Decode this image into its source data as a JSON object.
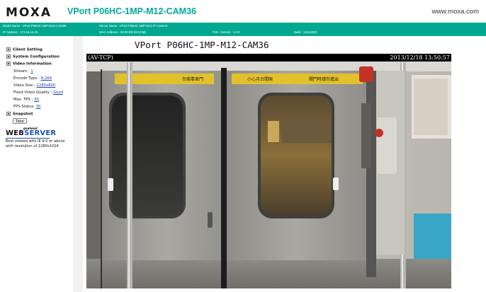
{
  "header": {
    "logo": "MOXA",
    "product_title": "VPort P06HC-1MP-M12-CAM36",
    "site_url": "www.moxa.com"
  },
  "info_bar": {
    "model_name": "Model Name : VPort P06HC-1MP-M12-CAM36",
    "server_name": "Server Name : VPort P06HC-1MP-M12 IP Camera",
    "ip_address": "IP Address : 172.16.16.32",
    "mac_address": "MAC Address : 00:90:E8:33:E3:5B",
    "firmware": "Firm. Version : 1.0.0",
    "build": "Build : 13112020"
  },
  "sidebar": {
    "client_setting": "Client Setting",
    "system_configuration": "System Configuration",
    "video_information": "Video Information",
    "stream_label": "Stream : ",
    "stream_value": "1",
    "encode_label": "Encode Type : ",
    "encode_value": "H.264",
    "video_size_label": "Video Size : ",
    "video_size_value": "1280x800",
    "fixed_quality_label": "Fixed Video Quality : ",
    "fixed_quality_value": "Good",
    "max_fps_label": "Max. FPS : ",
    "max_fps_value": "30",
    "fps_status_label": "FPS Status: ",
    "fps_status_value": "30",
    "snapshot": "Snapshot",
    "take_button": "Take",
    "webserver_top": "goahead",
    "webserver_main_a": "WEB",
    "webserver_main_b": "SERVER",
    "browser_note": "Best viewed with IE 9.0 or above with resolution of 1280x1024"
  },
  "video": {
    "title": "VPort P06HC-1MP-M12-CAM36",
    "overlay_left": "(AV-TCP)",
    "overlay_right": "2013/12/18 13:50:57",
    "sign_left": "勿倚靠車門",
    "sign_middle": "小心月台間隙",
    "sign_right": "關門時請勿進出"
  },
  "colors": {
    "brand_teal": "#00a88f",
    "link_blue": "#1a3fb0"
  }
}
